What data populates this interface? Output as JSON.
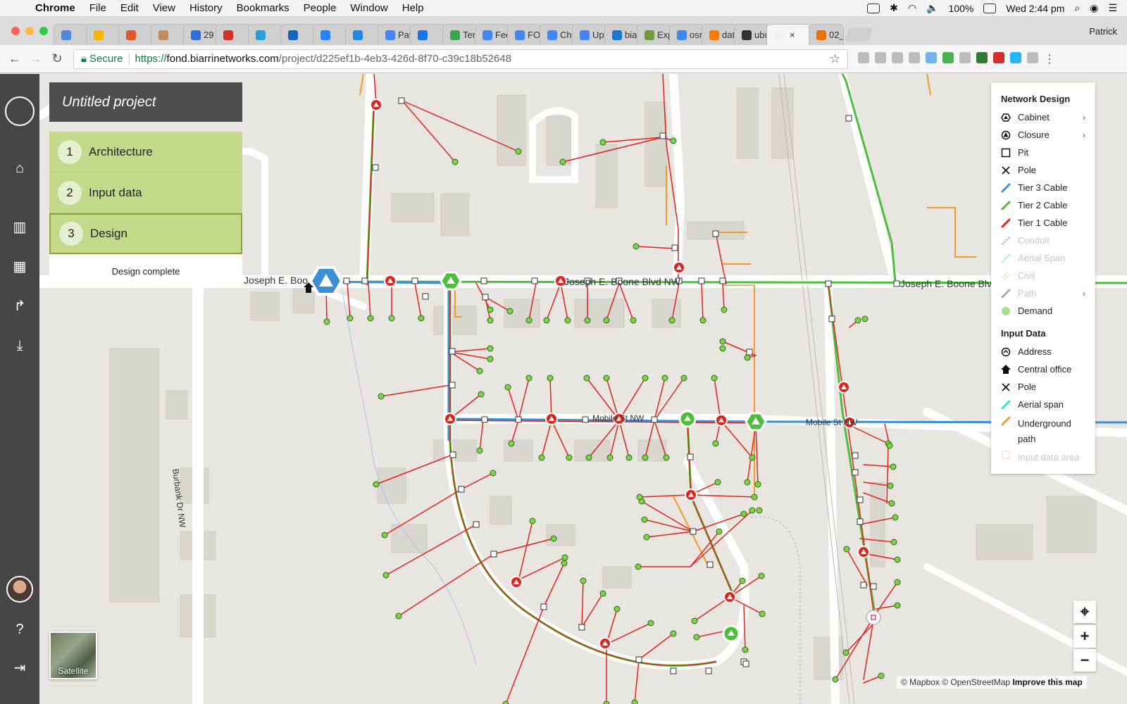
{
  "menubar": {
    "app": "Chrome",
    "items": [
      "File",
      "Edit",
      "View",
      "History",
      "Bookmarks",
      "People",
      "Window",
      "Help"
    ],
    "battery": "100%",
    "clock": "Wed 2:44 pm"
  },
  "tabs": {
    "labels": [
      "",
      "",
      "",
      "",
      "29",
      "",
      "",
      "",
      "",
      "",
      "Pat",
      "",
      "Ten",
      "Fee",
      "FO",
      "Ch",
      "Upl",
      "bia",
      "Exp",
      "osr",
      "dat",
      "ubu",
      "",
      "02_"
    ],
    "active_index": 22,
    "profile": "Patrick"
  },
  "address": {
    "secure_label": "Secure",
    "scheme": "https://",
    "host": "fond.biarrinetworks.com",
    "path": "/project/d225ef1b-4eb3-426d-8f70-c39c18b52648"
  },
  "project": {
    "title": "Untitled project",
    "steps": [
      {
        "num": "1",
        "label": "Architecture"
      },
      {
        "num": "2",
        "label": "Input data"
      },
      {
        "num": "3",
        "label": "Design"
      }
    ],
    "status": "Design complete"
  },
  "map_labels": {
    "street1": "Joseph E. Boo",
    "street1b": "Joseph E. Boone Blvd NW",
    "street1c": "Joseph E. Boone Blv",
    "street2": "Mobile St NW",
    "street2b": "Mobile St NW",
    "street3": "Burbank Dr NW"
  },
  "legend": {
    "network_title": "Network Design",
    "network": [
      {
        "label": "Cabinet",
        "icon": "cabinet-icon",
        "chevron": true,
        "dim": false
      },
      {
        "label": "Closure",
        "icon": "closure-icon",
        "chevron": true,
        "dim": false
      },
      {
        "label": "Pit",
        "icon": "pit-icon",
        "chevron": false,
        "dim": false
      },
      {
        "label": "Pole",
        "icon": "pole-icon",
        "chevron": false,
        "dim": false
      },
      {
        "label": "Tier 3 Cable",
        "icon": "line-icon",
        "color": "#3b8fd6",
        "chevron": false,
        "dim": false
      },
      {
        "label": "Tier 2 Cable",
        "icon": "line-icon",
        "color": "#4cbf3a",
        "chevron": false,
        "dim": false
      },
      {
        "label": "Tier 1 Cable",
        "icon": "line-icon",
        "color": "#e2231a",
        "chevron": false,
        "dim": false
      },
      {
        "label": "Conduit",
        "icon": "dashed-line-icon",
        "chevron": false,
        "dim": true
      },
      {
        "label": "Aerial Span",
        "icon": "line-icon",
        "color": "#38d9d9",
        "chevron": false,
        "dim": true
      },
      {
        "label": "Civil",
        "icon": "double-line-icon",
        "color": "#f0a050",
        "chevron": false,
        "dim": true
      },
      {
        "label": "Path",
        "icon": "line-icon",
        "color": "#111111",
        "chevron": true,
        "dim": true
      },
      {
        "label": "Demand",
        "icon": "dot-icon",
        "color": "#a7df8f",
        "chevron": false,
        "dim": false
      }
    ],
    "input_title": "Input Data",
    "input": [
      {
        "label": "Address",
        "icon": "address-icon",
        "dim": false
      },
      {
        "label": "Central office",
        "icon": "house-icon",
        "dim": false
      },
      {
        "label": "Pole",
        "icon": "pole-icon",
        "dim": false
      },
      {
        "label": "Aerial span",
        "icon": "line-icon",
        "color": "#38e0e0",
        "dim": false
      },
      {
        "label": "Underground path",
        "icon": "line-icon",
        "color": "#f39a2b",
        "dim": false
      },
      {
        "label": "Input data area",
        "icon": "area-icon",
        "color": "#f3b37a",
        "dim": true
      }
    ]
  },
  "map_controls": {
    "satellite": "Satellite",
    "attribution_1": "© Mapbox",
    "attribution_2": "© OpenStreetMap",
    "attribution_3": "Improve this map"
  },
  "colors": {
    "tier1": "#e2231a",
    "tier2": "#4cbf3a",
    "tier3": "#3b8fd6",
    "underground": "#f39a2b",
    "demand": "#7fd14a",
    "panel_green": "#c4d88a"
  }
}
